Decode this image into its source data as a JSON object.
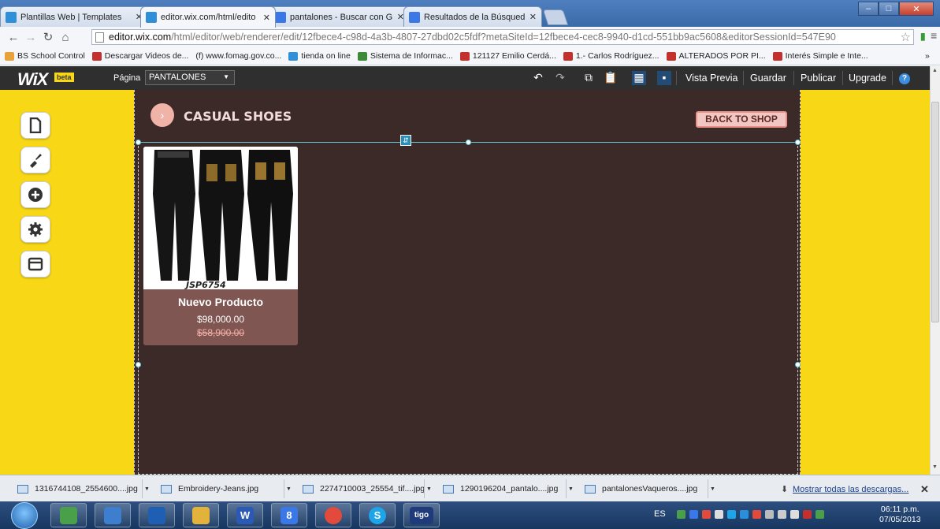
{
  "browser": {
    "tabs": [
      {
        "title": "Plantillas Web | Templates",
        "active": false,
        "icon": "wix-favicon-icon",
        "color": "#2f8fd8"
      },
      {
        "title": "editor.wix.com/html/edito",
        "active": true,
        "icon": "wix-favicon-icon",
        "color": "#2f8fd8"
      },
      {
        "title": "pantalones - Buscar con G",
        "active": false,
        "icon": "google-favicon-icon",
        "color": "#3b78e7"
      },
      {
        "title": "Resultados de la Búsqued",
        "active": false,
        "icon": "google-favicon-icon",
        "color": "#3b78e7"
      }
    ],
    "url_host": "editor.wix.com",
    "url_path": "/html/editor/web/renderer/edit/12fbece4-c98d-4a3b-4807-27dbd02c5fdf?metaSiteId=12fbece4-cec8-9940-d1cd-551bb9ac5608&editorSessionId=547E90",
    "bookmarks": [
      {
        "label": "BS School Control",
        "color": "#e9a23b"
      },
      {
        "label": "Descargar Videos de...",
        "color": "#c4302b"
      },
      {
        "label": "(f) www.fomag.gov.co...",
        "color": "#777777"
      },
      {
        "label": "tienda on line",
        "color": "#2f8fd8"
      },
      {
        "label": "Sistema de Informac...",
        "color": "#3a8a3a"
      },
      {
        "label": "121127 Emilio Cerdá...",
        "color": "#c4302b"
      },
      {
        "label": "1.- Carlos Rodríguez...",
        "color": "#c4302b"
      },
      {
        "label": "ALTERADOS POR PI...",
        "color": "#c4302b"
      },
      {
        "label": "Interés Simple e Inte...",
        "color": "#c4302b"
      }
    ],
    "bookmarks_more": "»"
  },
  "wix": {
    "logo": "WiX",
    "beta": "beta",
    "page_label": "Página",
    "page_value": "PANTALONES",
    "preview": "Vista Previa",
    "save": "Guardar",
    "publish": "Publicar",
    "upgrade": "Upgrade",
    "help": "?"
  },
  "site": {
    "header_title": "CASUAL SHOES",
    "back_button": "BACK TO SHOP",
    "colors": {
      "background": "#3b2a28",
      "stage": "#f7d716",
      "card": "#7f5652",
      "accent": "#f2c6c3"
    },
    "product": {
      "name": "Nuevo Producto",
      "price": "$98,000.00",
      "old_price": "$58,900.00",
      "image_code": "JSP6754"
    }
  },
  "downloads": {
    "items": [
      "1316744108_2554600....jpg",
      "Embroidery-Jeans.jpg",
      "2274710003_25554_tif....jpg",
      "1290196204_pantalo....jpg",
      "pantalonesVaqueros....jpg"
    ],
    "show_all": "Mostrar todas las descargas..."
  },
  "taskbar": {
    "apps": [
      {
        "name": "calculator",
        "color": "#4aa04a",
        "label": ""
      },
      {
        "name": "files",
        "color": "#3d7ecf",
        "label": ""
      },
      {
        "name": "media-player",
        "color": "#1f5fb3",
        "label": ""
      },
      {
        "name": "explorer",
        "color": "#e2b23a",
        "label": ""
      },
      {
        "name": "word",
        "color": "#2a5ab5",
        "label": "W"
      },
      {
        "name": "google",
        "color": "#3b78e7",
        "label": "8"
      },
      {
        "name": "chrome",
        "color": "#e24a3b",
        "label": ""
      },
      {
        "name": "skype",
        "color": "#1ea5e8",
        "label": "S"
      },
      {
        "name": "tigo",
        "color": "#1f3b7a",
        "label": "tigo"
      }
    ],
    "language": "ES",
    "time": "06:11 p.m.",
    "date": "07/05/2013"
  }
}
